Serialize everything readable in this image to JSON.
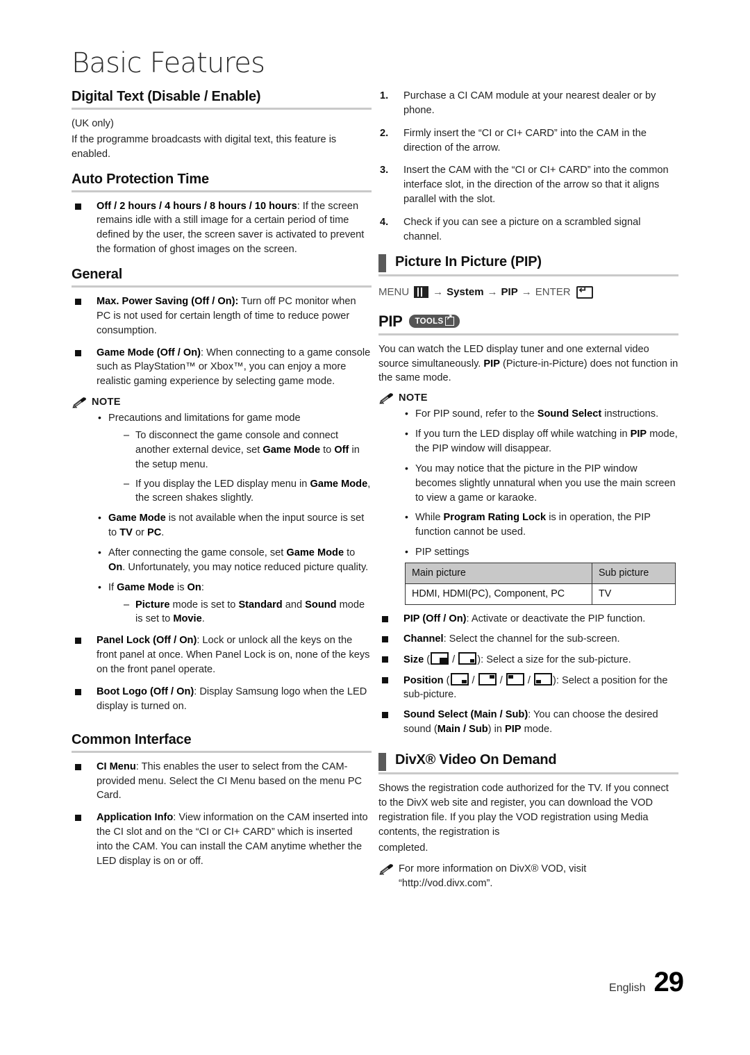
{
  "page": {
    "title": "Basic Features",
    "footer_language": "English",
    "footer_page_number": "29"
  },
  "left_column": {
    "digital_text": {
      "heading": "Digital Text (Disable / Enable)",
      "uk_only": "(UK only)",
      "body": "If the programme broadcasts with digital text, this feature is enabled."
    },
    "auto_protection": {
      "heading": "Auto Protection Time",
      "bullet_bold": "Off / 2 hours / 4 hours / 8 hours / 10 hours",
      "bullet_rest": ": If the screen remains idle with a still image for a certain period of time defined by the user, the screen saver is activated to prevent the formation of ghost images on the screen."
    },
    "general": {
      "heading": "General",
      "max_power_bold": "Max. Power Saving (Off / On):",
      "max_power_rest": " Turn off PC monitor when PC is not used for certain length of time to reduce power consumption.",
      "game_mode_bold": "Game Mode (Off / On)",
      "game_mode_rest": ": When connecting to a game console such as PlayStation™ or Xbox™, you can enjoy a more realistic gaming experience by selecting game mode.",
      "note_label": "NOTE",
      "note_1": "Precautions and limitations for game mode",
      "note_1_sub_1_a": "To disconnect the game console and connect another external device, set ",
      "note_1_sub_1_b": "Game Mode",
      "note_1_sub_1_c": " to ",
      "note_1_sub_1_d": "Off",
      "note_1_sub_1_e": " in the setup menu.",
      "note_1_sub_2_a": "If you display the LED display menu in ",
      "note_1_sub_2_b": "Game Mode",
      "note_1_sub_2_c": ", the screen shakes slightly.",
      "note_2_a": "Game Mode",
      "note_2_b": " is not available when the input source is set to ",
      "note_2_c": "TV",
      "note_2_d": " or ",
      "note_2_e": "PC",
      "note_2_f": ".",
      "note_3_a": "After connecting the game console, set ",
      "note_3_b": "Game Mode",
      "note_3_c": " to ",
      "note_3_d": "On",
      "note_3_e": ". Unfortunately, you may notice reduced picture quality.",
      "note_4_a": "If ",
      "note_4_b": "Game Mode",
      "note_4_c": " is ",
      "note_4_d": "On",
      "note_4_e": ":",
      "note_4_sub_a": "Picture",
      "note_4_sub_b": " mode is set to ",
      "note_4_sub_c": "Standard",
      "note_4_sub_d": " and ",
      "note_4_sub_e": "Sound",
      "note_4_sub_f": " mode is set to ",
      "note_4_sub_g": "Movie",
      "note_4_sub_h": ".",
      "panel_lock_bold": "Panel Lock (Off / On)",
      "panel_lock_rest": ": Lock or unlock all the keys on the front panel at once. When Panel Lock is on, none of the keys on the front panel operate.",
      "boot_logo_bold": "Boot Logo (Off / On)",
      "boot_logo_rest": ": Display Samsung logo when the LED display is turned on."
    },
    "common_interface": {
      "heading": "Common Interface",
      "ci_menu_bold": "CI Menu",
      "ci_menu_rest": ": This enables the user to select from the CAM-provided menu. Select the CI Menu based on the menu PC Card.",
      "app_info_bold": "Application Info",
      "app_info_rest": ": View information on the CAM inserted into the CI slot and on the “CI or CI+ CARD” which is inserted into the CAM. You can install the CAM anytime whether the LED display is on or off."
    }
  },
  "right_column": {
    "steps": [
      "Purchase a CI CAM module at your nearest dealer or by phone.",
      "Firmly insert the “CI or CI+ CARD” into the CAM in the direction of the arrow.",
      "Insert the CAM with the “CI or CI+ CARD” into the common interface slot, in the direction of the arrow so that it aligns parallel with the slot.",
      "Check if you can see a picture on a scrambled signal channel."
    ],
    "pip": {
      "heading": "Picture In Picture (PIP)",
      "menu_path": {
        "menu": "MENU",
        "arrow": "→",
        "system": "System",
        "pip": "PIP",
        "enter": "ENTER"
      },
      "pip_label": "PIP",
      "tools_badge": "TOOLS",
      "intro_a": "You can watch the LED display tuner and one external video source simultaneously. ",
      "intro_b": "PIP",
      "intro_c": " (Picture-in-Picture) does not function in the same mode.",
      "note_label": "NOTE",
      "notes": {
        "n1_a": "For PIP sound, refer to the ",
        "n1_b": "Sound Select",
        "n1_c": " instructions.",
        "n2_a": "If you turn the LED display off while watching in ",
        "n2_b": "PIP",
        "n2_c": " mode, the PIP window will disappear.",
        "n3": "You may notice that the picture in the PIP window becomes slightly unnatural when you use the main screen to view a game or karaoke.",
        "n4_a": "While ",
        "n4_b": "Program Rating Lock",
        "n4_c": " is in operation, the PIP function cannot be used.",
        "n5": "PIP settings"
      },
      "table": {
        "headers": [
          "Main picture",
          "Sub picture"
        ],
        "rows": [
          [
            "HDMI, HDMI(PC), Component, PC",
            "TV"
          ]
        ]
      },
      "settings": {
        "pip_bold": "PIP (Off / On)",
        "pip_rest": ": Activate or deactivate the PIP function.",
        "channel_bold": "Channel",
        "channel_rest": ": Select the channel for the sub-screen.",
        "size_bold": "Size",
        "size_open": " (",
        "size_sep": " / ",
        "size_close": "): Select a size for the sub-picture.",
        "position_bold": "Position",
        "position_open": " (",
        "position_sep": " / ",
        "position_close": "): Select a position for the sub-picture.",
        "sound_bold": "Sound Select (Main / Sub)",
        "sound_a": ": You can choose the desired sound (",
        "sound_b": "Main / Sub",
        "sound_c": ") in ",
        "sound_d": "PIP",
        "sound_e": " mode."
      }
    },
    "divx": {
      "heading": "DivX® Video On Demand",
      "body_1": "Shows the registration code authorized for the TV. If you connect to the DivX web site and register, you can download the VOD registration file. If you play the VOD registration using Media contents, the registration is",
      "body_2": "completed.",
      "note": "For more information on DivX® VOD, visit “http://vod.divx.com”."
    }
  }
}
